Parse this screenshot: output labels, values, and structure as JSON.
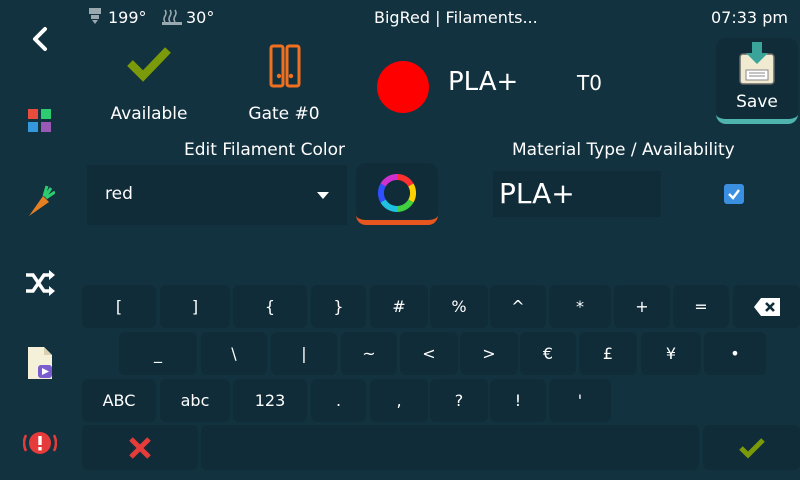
{
  "status": {
    "nozzle_temp": "199°",
    "bed_temp": "30°",
    "title": "BigRed | Filaments...",
    "time": "07:33 pm"
  },
  "sidebar": {
    "items": [
      {
        "name": "back",
        "icon": "chevron-left-icon"
      },
      {
        "name": "apps",
        "icon": "grid-icon"
      },
      {
        "name": "extrude",
        "icon": "carrot-icon"
      },
      {
        "name": "shuffle",
        "icon": "shuffle-icon"
      },
      {
        "name": "file",
        "icon": "video-file-icon"
      },
      {
        "name": "emergency-stop",
        "icon": "alert-icon"
      }
    ]
  },
  "header": {
    "available_label": "Available",
    "gate_label": "Gate #0",
    "material_name": "PLA+",
    "tool": "T0",
    "save_label": "Save",
    "swatch_color": "#ff0000"
  },
  "edit": {
    "color_title": "Edit Filament Color",
    "color_value": "red",
    "material_title": "Material Type / Availability",
    "material_value": "PLA+",
    "available_checked": true
  },
  "keyboard": {
    "row1": [
      "[",
      "]",
      "{",
      "}",
      "#",
      "%",
      "^",
      "*",
      "+",
      "="
    ],
    "row2": [
      "_",
      "\\",
      "|",
      "~",
      "<",
      ">",
      "€",
      "£",
      "¥",
      "•"
    ],
    "row3": [
      "ABC",
      "abc",
      "123",
      ".",
      ",",
      "?",
      "!",
      "'"
    ]
  },
  "colors": {
    "background": "#13323f",
    "panel": "#0f2c38",
    "check_green": "#7a9a0a",
    "cancel_red": "#e53b3b",
    "gate_orange": "#f07020",
    "accent_teal": "#4fb3ae"
  }
}
